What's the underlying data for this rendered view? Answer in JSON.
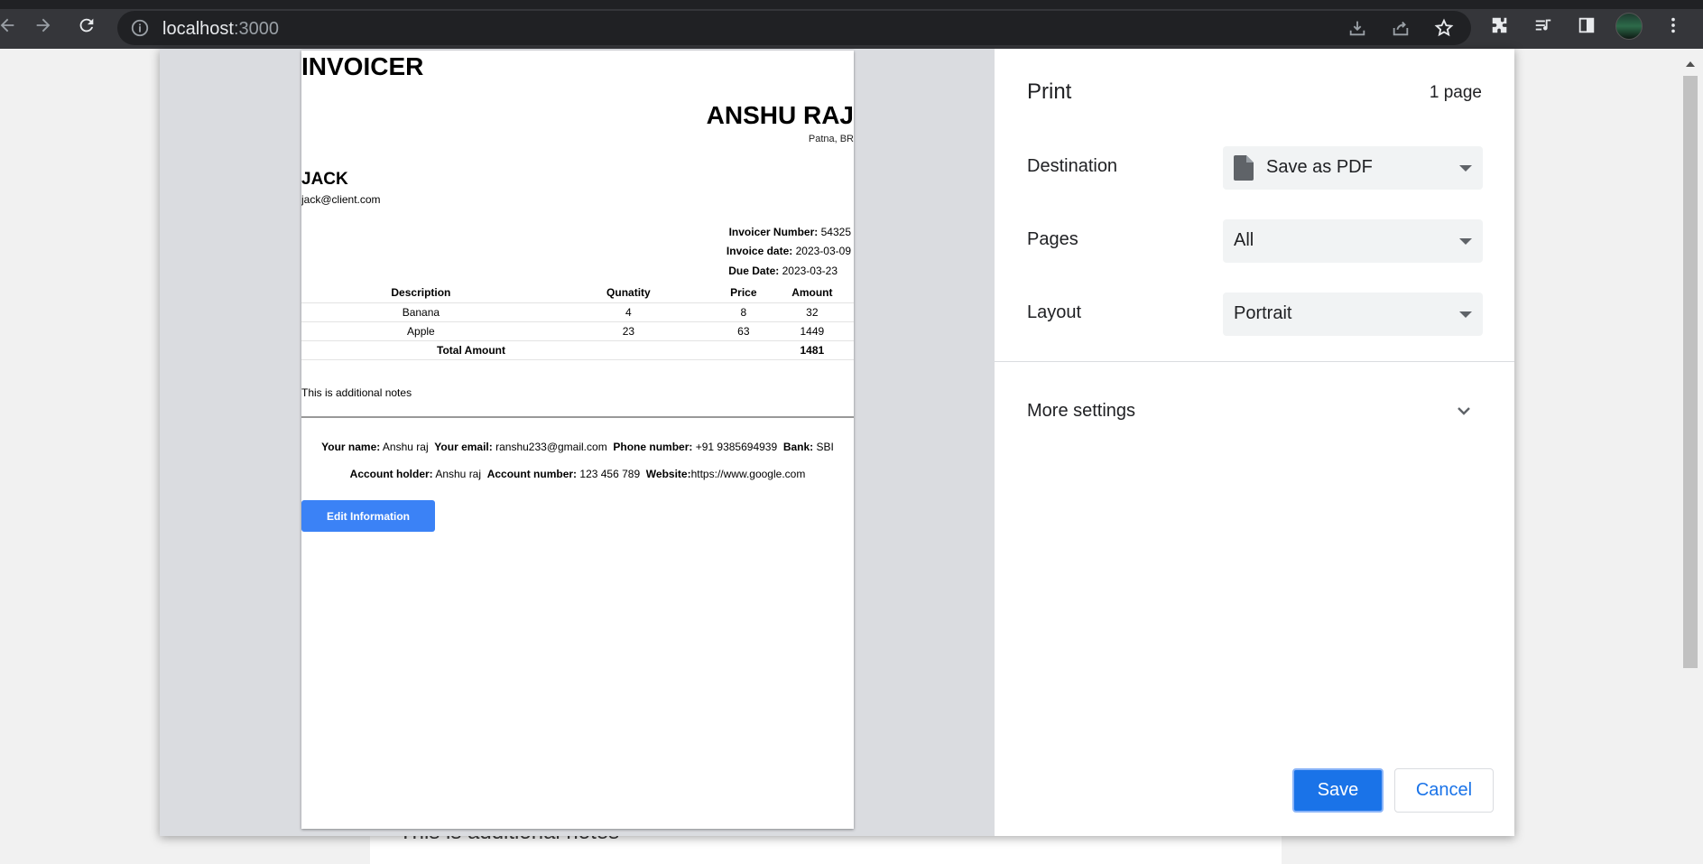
{
  "browser": {
    "url_host": "localhost",
    "url_port": ":3000",
    "icons": [
      "back-icon",
      "forward-icon",
      "reload-icon",
      "info-icon",
      "install-icon",
      "share-icon",
      "star-icon",
      "extensions-icon",
      "media-icon",
      "sidepanel-icon",
      "menu-icon"
    ]
  },
  "background_page": {
    "notes": "This is additional notes"
  },
  "invoice": {
    "title": "INVOICER",
    "sender_name": "ANSHU RAJ",
    "sender_city": "Patna, BR",
    "client_name": "JACK",
    "client_email": "jack@client.com",
    "meta": {
      "number_label": "Invoicer Number:",
      "number_value": "54325",
      "date_label": "Invoice date:",
      "date_value": "2023-03-09",
      "due_label": "Due Date:",
      "due_value": "2023-03-23"
    },
    "table": {
      "headers": [
        "Description",
        "Qunatity",
        "Price",
        "Amount"
      ],
      "rows": [
        [
          "Banana",
          "4",
          "8",
          "32"
        ],
        [
          "Apple",
          "23",
          "63",
          "1449"
        ]
      ],
      "total_label": "Total Amount",
      "total_value": "1481"
    },
    "notes": "This is additional notes",
    "footer": {
      "name_label": "Your name:",
      "name_value": "Anshu raj",
      "email_label": "Your email:",
      "email_value": "ranshu233@gmail.com",
      "phone_label": "Phone number:",
      "phone_value": "+91 9385694939",
      "bank_label": "Bank:",
      "bank_value": "SBI",
      "holder_label": "Account holder:",
      "holder_value": "Anshu raj",
      "account_label": "Account number:",
      "account_value": "123 456 789",
      "website_label": "Website:",
      "website_value": "https://www.google.com"
    },
    "edit_button": "Edit Information"
  },
  "print": {
    "title": "Print",
    "page_count": "1 page",
    "destination_label": "Destination",
    "destination_value": "Save as PDF",
    "pages_label": "Pages",
    "pages_value": "All",
    "layout_label": "Layout",
    "layout_value": "Portrait",
    "more_settings": "More settings",
    "save": "Save",
    "cancel": "Cancel",
    "accent": "#1a73e8"
  }
}
